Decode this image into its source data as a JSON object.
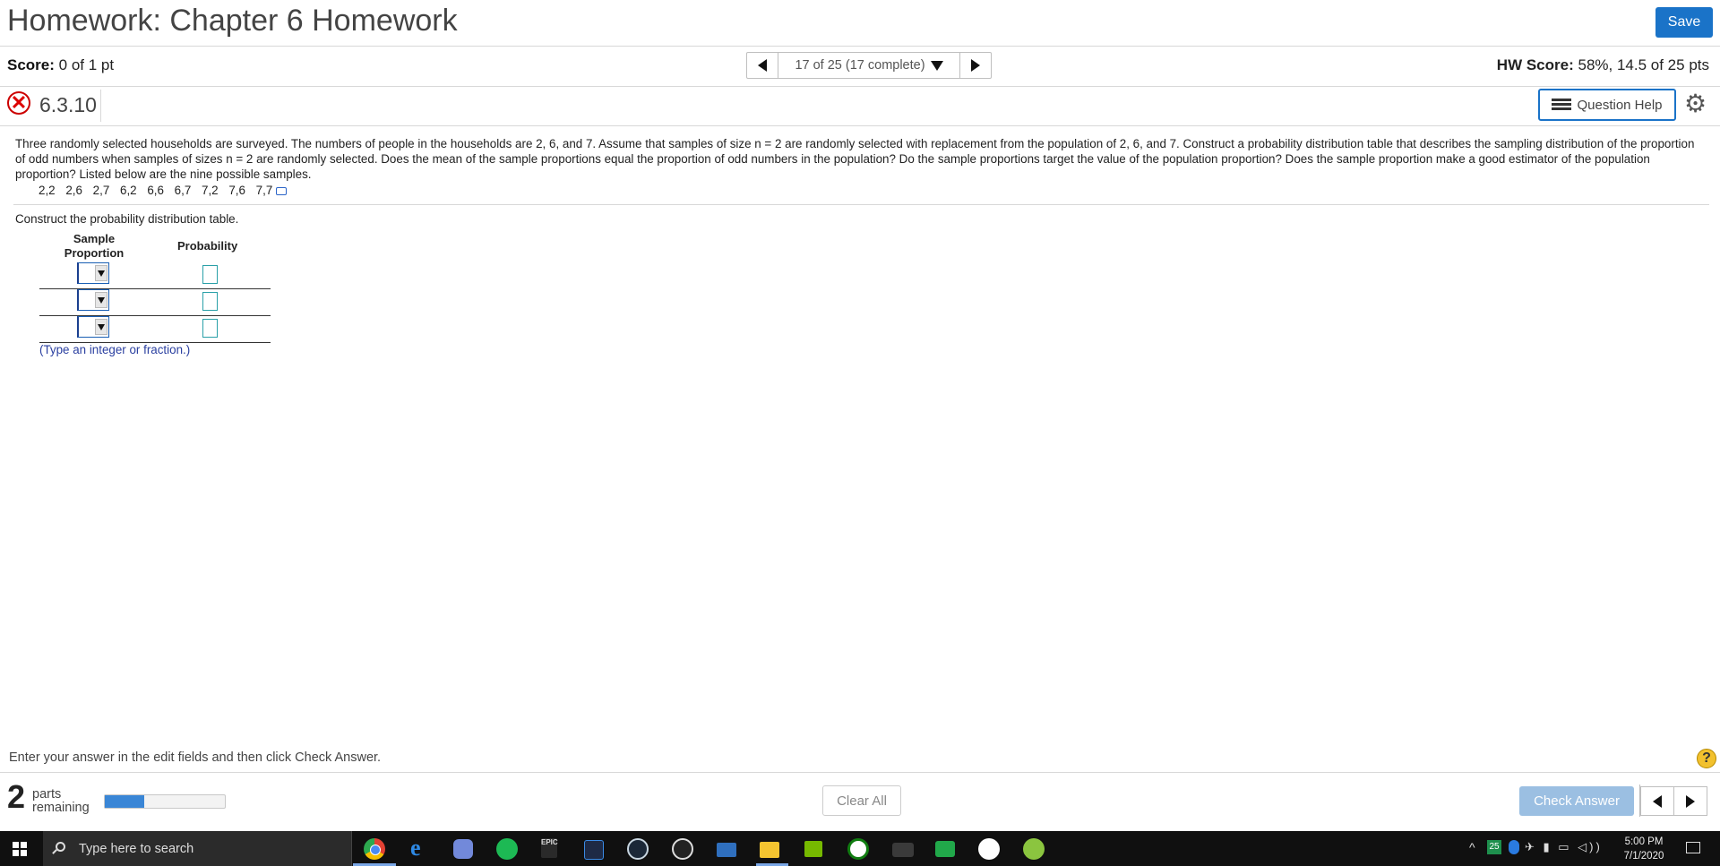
{
  "header": {
    "title": "Homework: Chapter 6 Homework",
    "save_label": "Save"
  },
  "score_bar": {
    "score_label": "Score:",
    "score_value": "0 of 1 pt",
    "nav_text": "17 of 25 (17 complete)",
    "hw_score_label": "HW Score:",
    "hw_score_value": "58%, 14.5 of 25 pts"
  },
  "question": {
    "number": "6.3.10",
    "help_label": "Question Help",
    "text": "Three randomly selected households are surveyed. The numbers of people in the households are 2, 6, and 7. Assume that samples of size n = 2 are randomly selected with replacement from the population of 2, 6, and 7. Construct a probability distribution table that describes the sampling distribution of the proportion of odd numbers when samples of sizes n = 2 are randomly selected. Does the mean of the sample proportions equal the proportion of odd numbers in the population? Do the sample proportions target the value of the population proportion? Does the sample proportion make a good estimator of the population proportion? Listed below are the nine possible samples.",
    "samples": "2,2  2,6  2,7  6,2  6,6  6,7  7,2  7,6  7,7",
    "instruction": "Construct the probability distribution table.",
    "table": {
      "col1_line1": "Sample",
      "col1_line2": "Proportion",
      "col2": "Probability",
      "rows": 3
    },
    "hint": "(Type an integer or fraction.)"
  },
  "footer": {
    "enter_text": "Enter your answer in the edit fields and then click Check Answer.",
    "help_symbol": "?",
    "parts_count": "2",
    "parts_line1": "parts",
    "parts_line2": "remaining",
    "progress_fraction": 0.33,
    "clear_label": "Clear All",
    "check_label": "Check Answer"
  },
  "taskbar": {
    "search_placeholder": "Type here to search",
    "epic_label": "EPIC",
    "tray_badge": "25",
    "time": "5:00 PM",
    "date": "7/1/2020"
  },
  "colors": {
    "accent": "#1a73c8",
    "error": "#cc0000",
    "progress": "#3a86d6"
  }
}
